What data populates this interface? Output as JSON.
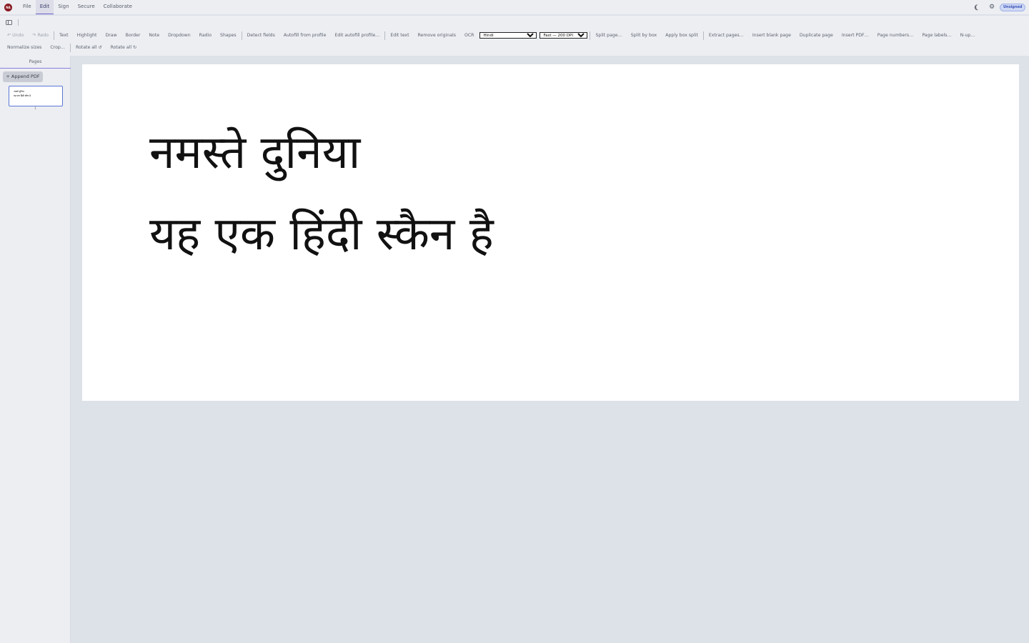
{
  "app": {
    "logo_text": "NA"
  },
  "menu": {
    "items": [
      {
        "label": "File",
        "active": false
      },
      {
        "label": "Edit",
        "active": true
      },
      {
        "label": "Sign",
        "active": false
      },
      {
        "label": "Secure",
        "active": false
      },
      {
        "label": "Collaborate",
        "active": false
      }
    ]
  },
  "header_right": {
    "theme_icon": "moon-icon",
    "settings_icon": "gear-icon",
    "badge": "Unsigned"
  },
  "toolbar": {
    "undo": "↶ Undo",
    "redo": "↷ Redo",
    "text": "Text",
    "highlight": "Highlight",
    "draw": "Draw",
    "border": "Border",
    "note": "Note",
    "dropdown": "Dropdown",
    "radio": "Radio",
    "shapes": "Shapes",
    "detect_fields": "Detect fields",
    "autofill_from_profile": "Autofill from profile",
    "edit_autofill_profile": "Edit autofill profile…",
    "edit_text": "Edit text",
    "remove_originals": "Remove originals",
    "ocr": "OCR",
    "ocr_language": "Hindi",
    "ocr_quality": "Fast — 200 DPI",
    "split_page": "Split page…",
    "split_by_box": "Split by box",
    "apply_box_split": "Apply box split",
    "extract_pages": "Extract pages…",
    "insert_blank_page": "Insert blank page",
    "duplicate_page": "Duplicate page",
    "insert_pdf": "Insert PDF…",
    "page_numbers": "Page numbers…",
    "page_labels": "Page labels…",
    "n_up": "N-up…",
    "normalize_sizes": "Normalize sizes",
    "crop": "Crop…",
    "rotate_all_ccw": "Rotate all ↺",
    "rotate_all_cw": "Rotate all ↻"
  },
  "sidebar": {
    "tab_label": "Pages",
    "append_button": "+ Append PDF",
    "thumbnail": {
      "line1": "नमस्ते दुनिया",
      "line2": "यह एक हिंदी स्कैन है",
      "page_number": "1"
    }
  },
  "document": {
    "line1": "नमस्ते दुनिया",
    "line2": "यह एक हिंदी स्कैन है"
  }
}
